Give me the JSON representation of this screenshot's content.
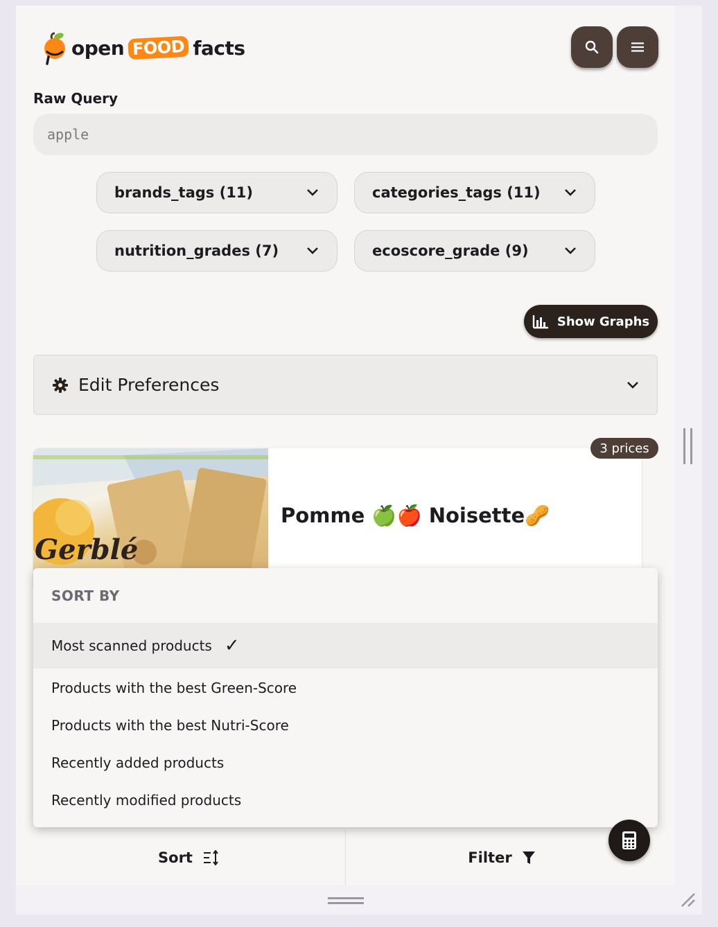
{
  "header": {
    "logo": {
      "open": "open",
      "food": "FOOD",
      "facts": "facts"
    },
    "search_icon": "search-icon",
    "menu_icon": "hamburger-menu-icon"
  },
  "query": {
    "label": "Raw Query",
    "value": "apple"
  },
  "facets": [
    {
      "label": "brands_tags (11)"
    },
    {
      "label": "categories_tags (11)"
    },
    {
      "label": "nutrition_grades (7)"
    },
    {
      "label": "ecoscore_grade (9)"
    }
  ],
  "show_graphs": {
    "label": "Show Graphs",
    "icon": "bar-chart-icon"
  },
  "preferences": {
    "label": "Edit Preferences",
    "icon": "gear-icon"
  },
  "product": {
    "name": "Pomme 🍏🍎 Noisette🥜",
    "prices": "3 prices",
    "image_text": "Gerblé"
  },
  "sort_menu": {
    "header": "SORT BY",
    "items": [
      {
        "label": "Most scanned products",
        "selected": true
      },
      {
        "label": "Products with the best Green-Score",
        "selected": false
      },
      {
        "label": "Products with the best Nutri-Score",
        "selected": false
      },
      {
        "label": "Recently added products",
        "selected": false
      },
      {
        "label": "Recently modified products",
        "selected": false
      }
    ]
  },
  "bottom_bar": {
    "sort": "Sort",
    "filter": "Filter"
  },
  "colors": {
    "brand_orange": "#ff8714",
    "button_brown": "#4d3f37",
    "dark": "#2b211d"
  }
}
